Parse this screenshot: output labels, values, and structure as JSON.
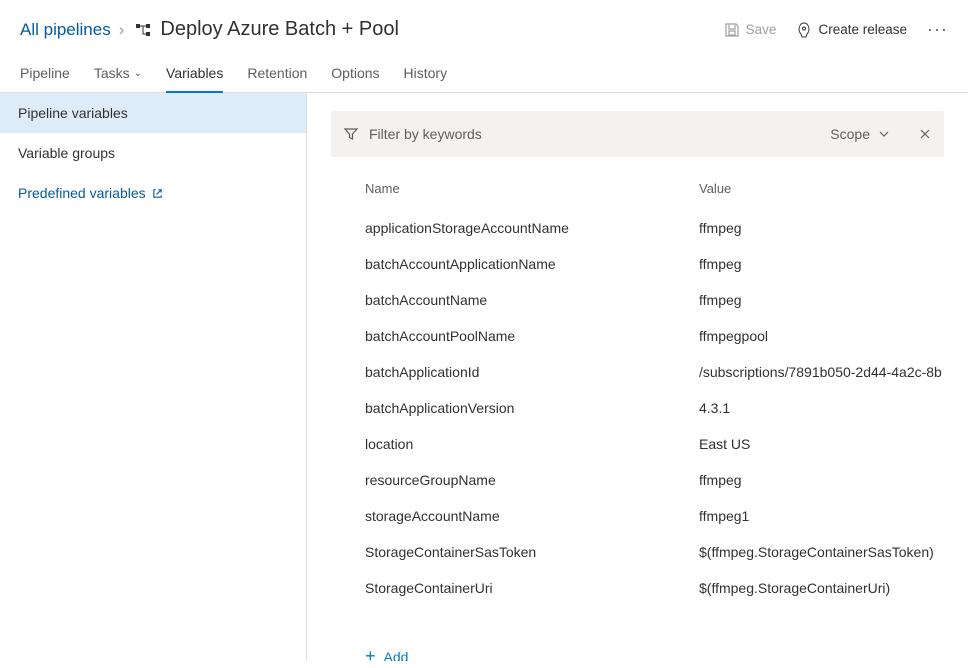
{
  "breadcrumb": {
    "root": "All pipelines"
  },
  "title": "Deploy Azure Batch + Pool",
  "actions": {
    "save": "Save",
    "create_release": "Create release"
  },
  "tabs": {
    "pipeline": "Pipeline",
    "tasks": "Tasks",
    "variables": "Variables",
    "retention": "Retention",
    "options": "Options",
    "history": "History"
  },
  "sidebar": {
    "pipeline_variables": "Pipeline variables",
    "variable_groups": "Variable groups",
    "predefined": "Predefined variables"
  },
  "filter": {
    "placeholder": "Filter by keywords",
    "scope_label": "Scope"
  },
  "columns": {
    "name": "Name",
    "value": "Value"
  },
  "variables": [
    {
      "name": "applicationStorageAccountName",
      "value": "ffmpeg"
    },
    {
      "name": "batchAccountApplicationName",
      "value": "ffmpeg"
    },
    {
      "name": "batchAccountName",
      "value": "ffmpeg"
    },
    {
      "name": "batchAccountPoolName",
      "value": "ffmpegpool"
    },
    {
      "name": "batchApplicationId",
      "value": "/subscriptions/7891b050-2d44-4a2c-8b"
    },
    {
      "name": "batchApplicationVersion",
      "value": "4.3.1"
    },
    {
      "name": "location",
      "value": "East US"
    },
    {
      "name": "resourceGroupName",
      "value": "ffmpeg"
    },
    {
      "name": "storageAccountName",
      "value": "ffmpeg1"
    },
    {
      "name": "StorageContainerSasToken",
      "value": "$(ffmpeg.StorageContainerSasToken)"
    },
    {
      "name": "StorageContainerUri",
      "value": "$(ffmpeg.StorageContainerUri)"
    }
  ],
  "add_label": "Add"
}
